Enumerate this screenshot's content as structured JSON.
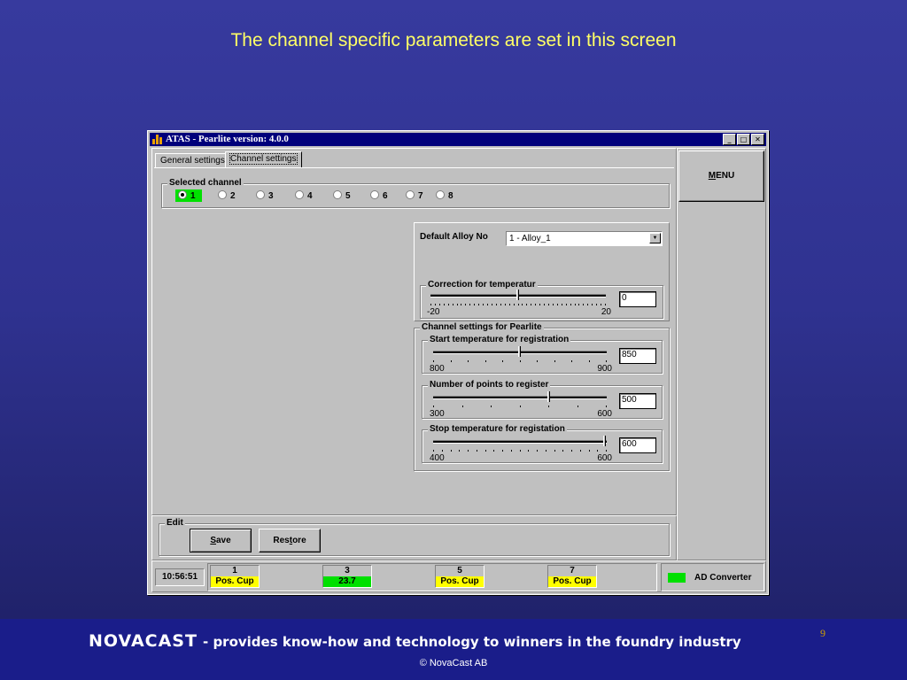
{
  "slide": {
    "title": "The channel specific parameters are set in this screen",
    "brand": "NOVACAST",
    "tagline": "- provides know-how and technology to winners in the foundry industry",
    "page_number": "9",
    "copyright": "© NovaCast AB"
  },
  "window": {
    "title": "ATAS - Pearlite version: 4.0.0",
    "minimize_glyph": "_",
    "maximize_glyph": "□",
    "close_glyph": "✕"
  },
  "tabs": [
    {
      "label": "General settings",
      "active": false
    },
    {
      "label": "Channel settings",
      "active": true
    }
  ],
  "selected_channel": {
    "label": "Selected channel",
    "options": [
      "1",
      "2",
      "3",
      "4",
      "5",
      "6",
      "7",
      "8"
    ],
    "selected": "1",
    "highlight_color": "#00e000"
  },
  "default_alloy": {
    "label": "Default Alloy No",
    "value": "1 - Alloy_1",
    "arrow_glyph": "▼"
  },
  "correction": {
    "label": "Correction for temperatur",
    "min": "-20",
    "max": "20",
    "value": "0"
  },
  "channel_settings": {
    "label": "Channel settings for Pearlite",
    "start_temp": {
      "label": "Start temperature for registration",
      "min": "800",
      "max": "900",
      "value": "850"
    },
    "points": {
      "label": "Number of points to register",
      "min": "300",
      "max": "600",
      "value": "500"
    },
    "stop_temp": {
      "label": "Stop temperature for registation",
      "min": "400",
      "max": "600",
      "value": "600"
    }
  },
  "menu_button": {
    "prefix": "M",
    "rest": "ENU"
  },
  "edit": {
    "label": "Edit",
    "save_prefix": "S",
    "save_rest": "ave",
    "restore_prefix": "Res",
    "restore_key": "t",
    "restore_rest": "ore"
  },
  "status": {
    "time": "10:56:51",
    "channels": [
      {
        "num": "1",
        "value": "Pos. Cup",
        "color": "#ffff00"
      },
      {
        "num": "3",
        "value": "23.7",
        "color": "#00e000"
      },
      {
        "num": "5",
        "value": "Pos. Cup",
        "color": "#ffff00"
      },
      {
        "num": "7",
        "value": "Pos. Cup",
        "color": "#ffff00"
      }
    ],
    "ad_converter": {
      "label": "AD Converter",
      "indicator_color": "#00e000"
    }
  }
}
